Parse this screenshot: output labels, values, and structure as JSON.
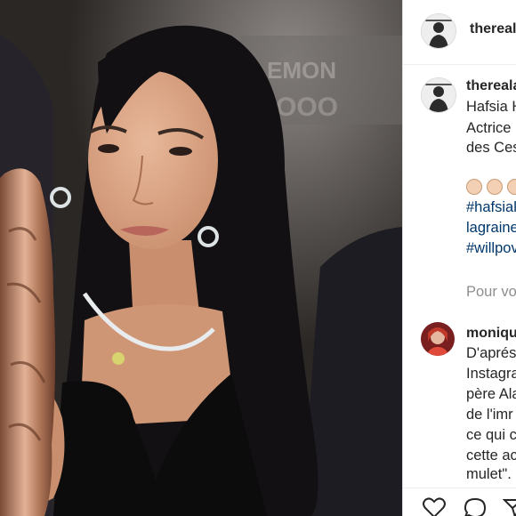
{
  "post": {
    "author": "thereal",
    "avatar_icon": "profile-avatar-icon"
  },
  "caption": {
    "username": "thereala",
    "lines": [
      "Hafsia H",
      "Actrice",
      "des Ces"
    ],
    "claps": "👏🏻👏🏻👏🏻",
    "hashtags": [
      "#hafsial",
      "lagraine",
      "#willpov"
    ]
  },
  "comment_prompt": "Pour vo",
  "comment": {
    "username": "moniqu",
    "lines": [
      "D'aprés",
      "Instagra",
      "père Ala",
      "de l'imr",
      "ce qui c",
      "cette ac",
      "mulet\"."
    ]
  },
  "actions": {
    "like_icon": "heart-icon",
    "comment_icon": "comment-icon",
    "share_icon": "share-icon"
  },
  "colors": {
    "text": "#262626",
    "hashtag": "#00376b",
    "muted": "#8e8e8e",
    "border": "#dbdbdb"
  }
}
